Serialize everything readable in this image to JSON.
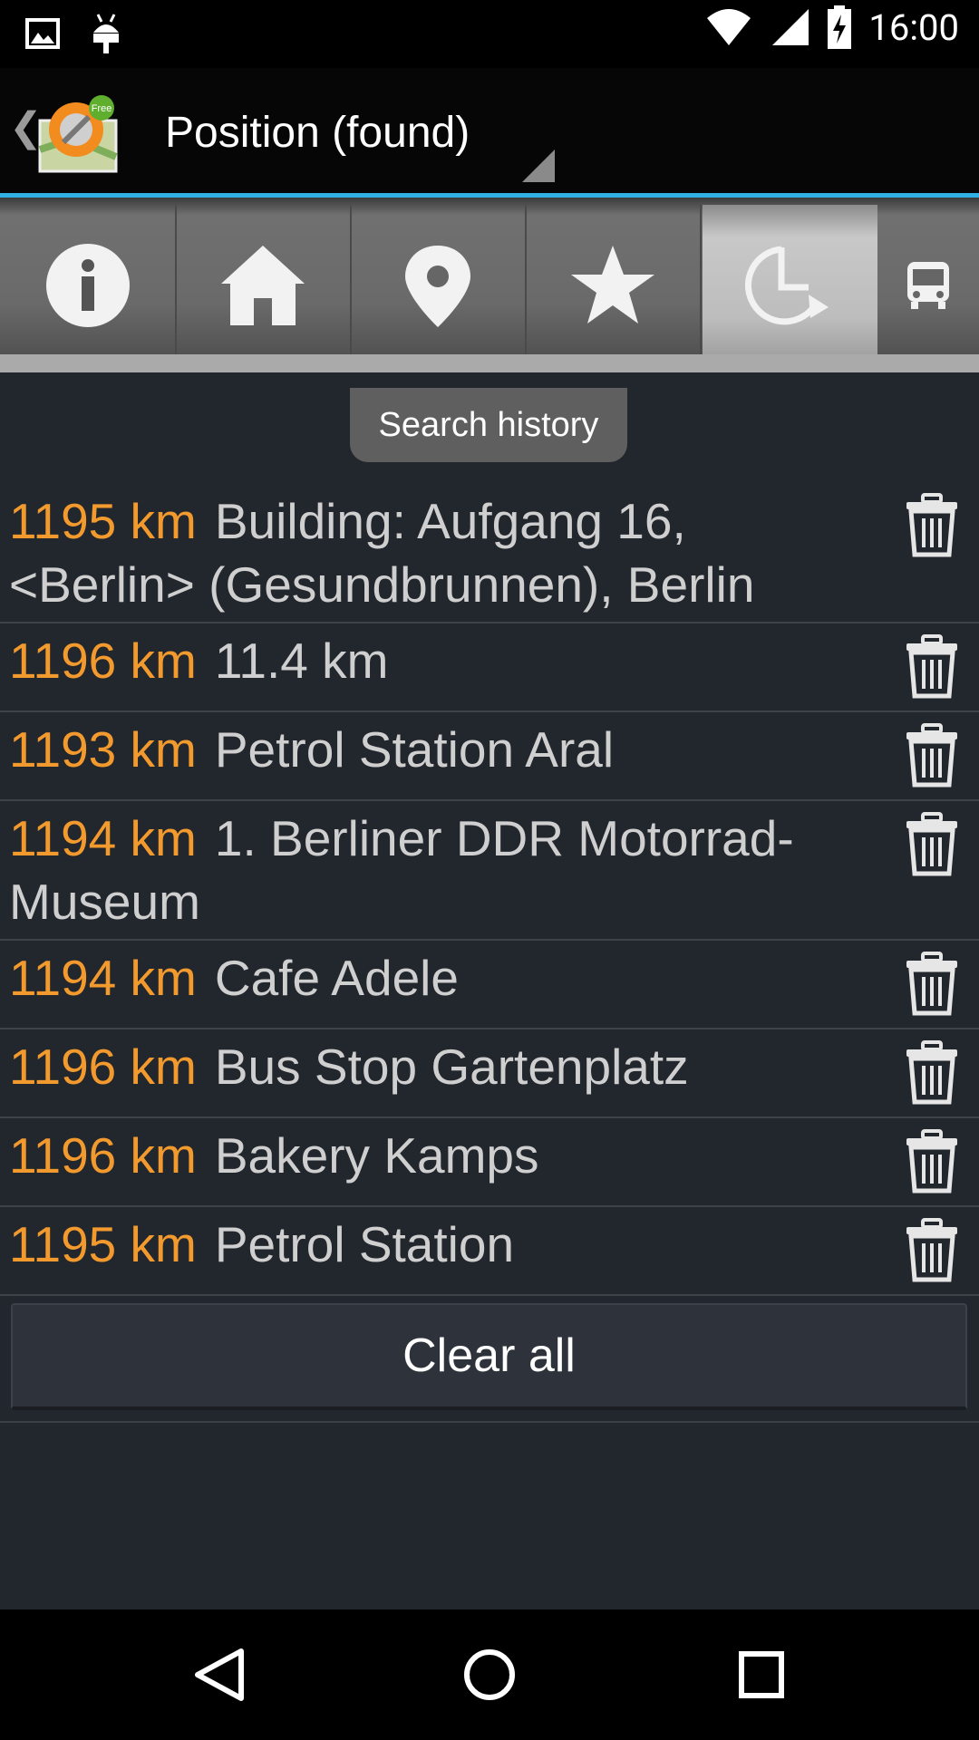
{
  "status_bar": {
    "time": "16:00",
    "icons": [
      "image-icon",
      "android-debug-icon",
      "wifi-icon",
      "signal-icon",
      "battery-charging-icon"
    ]
  },
  "action_bar": {
    "title": "Position (found)",
    "app_badge": "Free"
  },
  "tabs": [
    {
      "icon": "info-icon",
      "active": false
    },
    {
      "icon": "home-icon",
      "active": false
    },
    {
      "icon": "map-pin-icon",
      "active": false
    },
    {
      "icon": "star-icon",
      "active": false
    },
    {
      "icon": "search-history-icon",
      "active": true
    },
    {
      "icon": "bus-icon",
      "active": false
    }
  ],
  "tooltip": "Search history",
  "history": [
    {
      "distance": "1195 km",
      "name": "Building: Aufgang 16, <Berlin> (Gesundbrunnen), Berlin"
    },
    {
      "distance": "1196 km",
      "name": "11.4 km"
    },
    {
      "distance": "1193 km",
      "name": "Petrol Station Aral"
    },
    {
      "distance": "1194 km",
      "name": "1. Berliner DDR Motorrad-Museum"
    },
    {
      "distance": "1194 km",
      "name": "Cafe Adele"
    },
    {
      "distance": "1196 km",
      "name": "Bus Stop Gartenplatz"
    },
    {
      "distance": "1196 km",
      "name": "Bakery Kamps"
    },
    {
      "distance": "1195 km",
      "name": "Petrol Station"
    }
  ],
  "clear_all_label": "Clear all",
  "colors": {
    "accent_blue": "#31b0e4",
    "distance_orange": "#f39a2e",
    "background": "#22262d"
  }
}
